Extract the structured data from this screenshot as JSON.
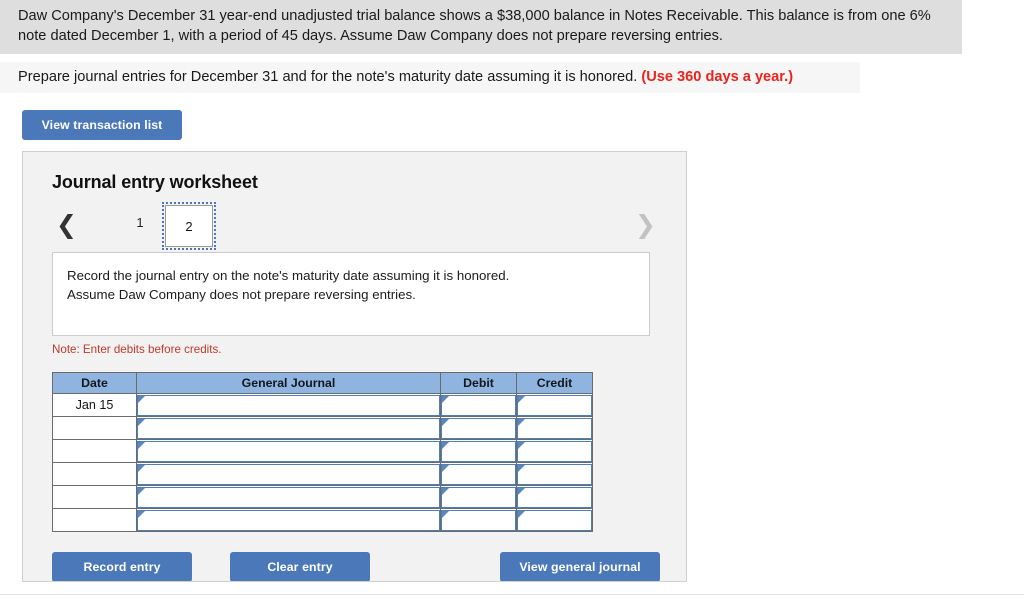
{
  "problem": {
    "paragraph1": "Daw Company's December 31 year-end unadjusted trial balance shows a $38,000 balance in Notes Receivable. This balance is from one 6% note dated December 1, with a period of 45 days. Assume Daw Company does not prepare reversing entries.",
    "paragraph2_before": "Prepare journal entries for December 31 and for the note's maturity date assuming it is honored. ",
    "paragraph2_emphasis": "(Use 360 days a year.)"
  },
  "toolbar": {
    "view_transaction_list": "View transaction list"
  },
  "worksheet": {
    "title": "Journal entry worksheet",
    "pager": {
      "prev_icon": "chevron-left-icon",
      "next_icon": "chevron-right-icon",
      "pages": [
        "1",
        "2"
      ],
      "selected": "2"
    },
    "instruction_line1": "Record the journal entry on the note's maturity date assuming it is honored.",
    "instruction_line2": "Assume Daw Company does not prepare reversing entries.",
    "note": "Note: Enter debits before credits.",
    "table": {
      "headers": [
        "Date",
        "General Journal",
        "Debit",
        "Credit"
      ],
      "rows": [
        {
          "date": "Jan 15",
          "general_journal": "",
          "debit": "",
          "credit": ""
        },
        {
          "date": "",
          "general_journal": "",
          "debit": "",
          "credit": ""
        },
        {
          "date": "",
          "general_journal": "",
          "debit": "",
          "credit": ""
        },
        {
          "date": "",
          "general_journal": "",
          "debit": "",
          "credit": ""
        },
        {
          "date": "",
          "general_journal": "",
          "debit": "",
          "credit": ""
        },
        {
          "date": "",
          "general_journal": "",
          "debit": "",
          "credit": ""
        }
      ]
    },
    "actions": {
      "record_entry": "Record entry",
      "clear_entry": "Clear entry",
      "view_general_journal": "View general journal"
    }
  },
  "colors": {
    "button_blue": "#4a78b8",
    "table_header_blue": "#8fb4df",
    "note_red": "#c0392b",
    "emphasis_red": "#e8241c",
    "panel_bg": "#f2f2f2",
    "highlight_gray": "#dedede"
  }
}
